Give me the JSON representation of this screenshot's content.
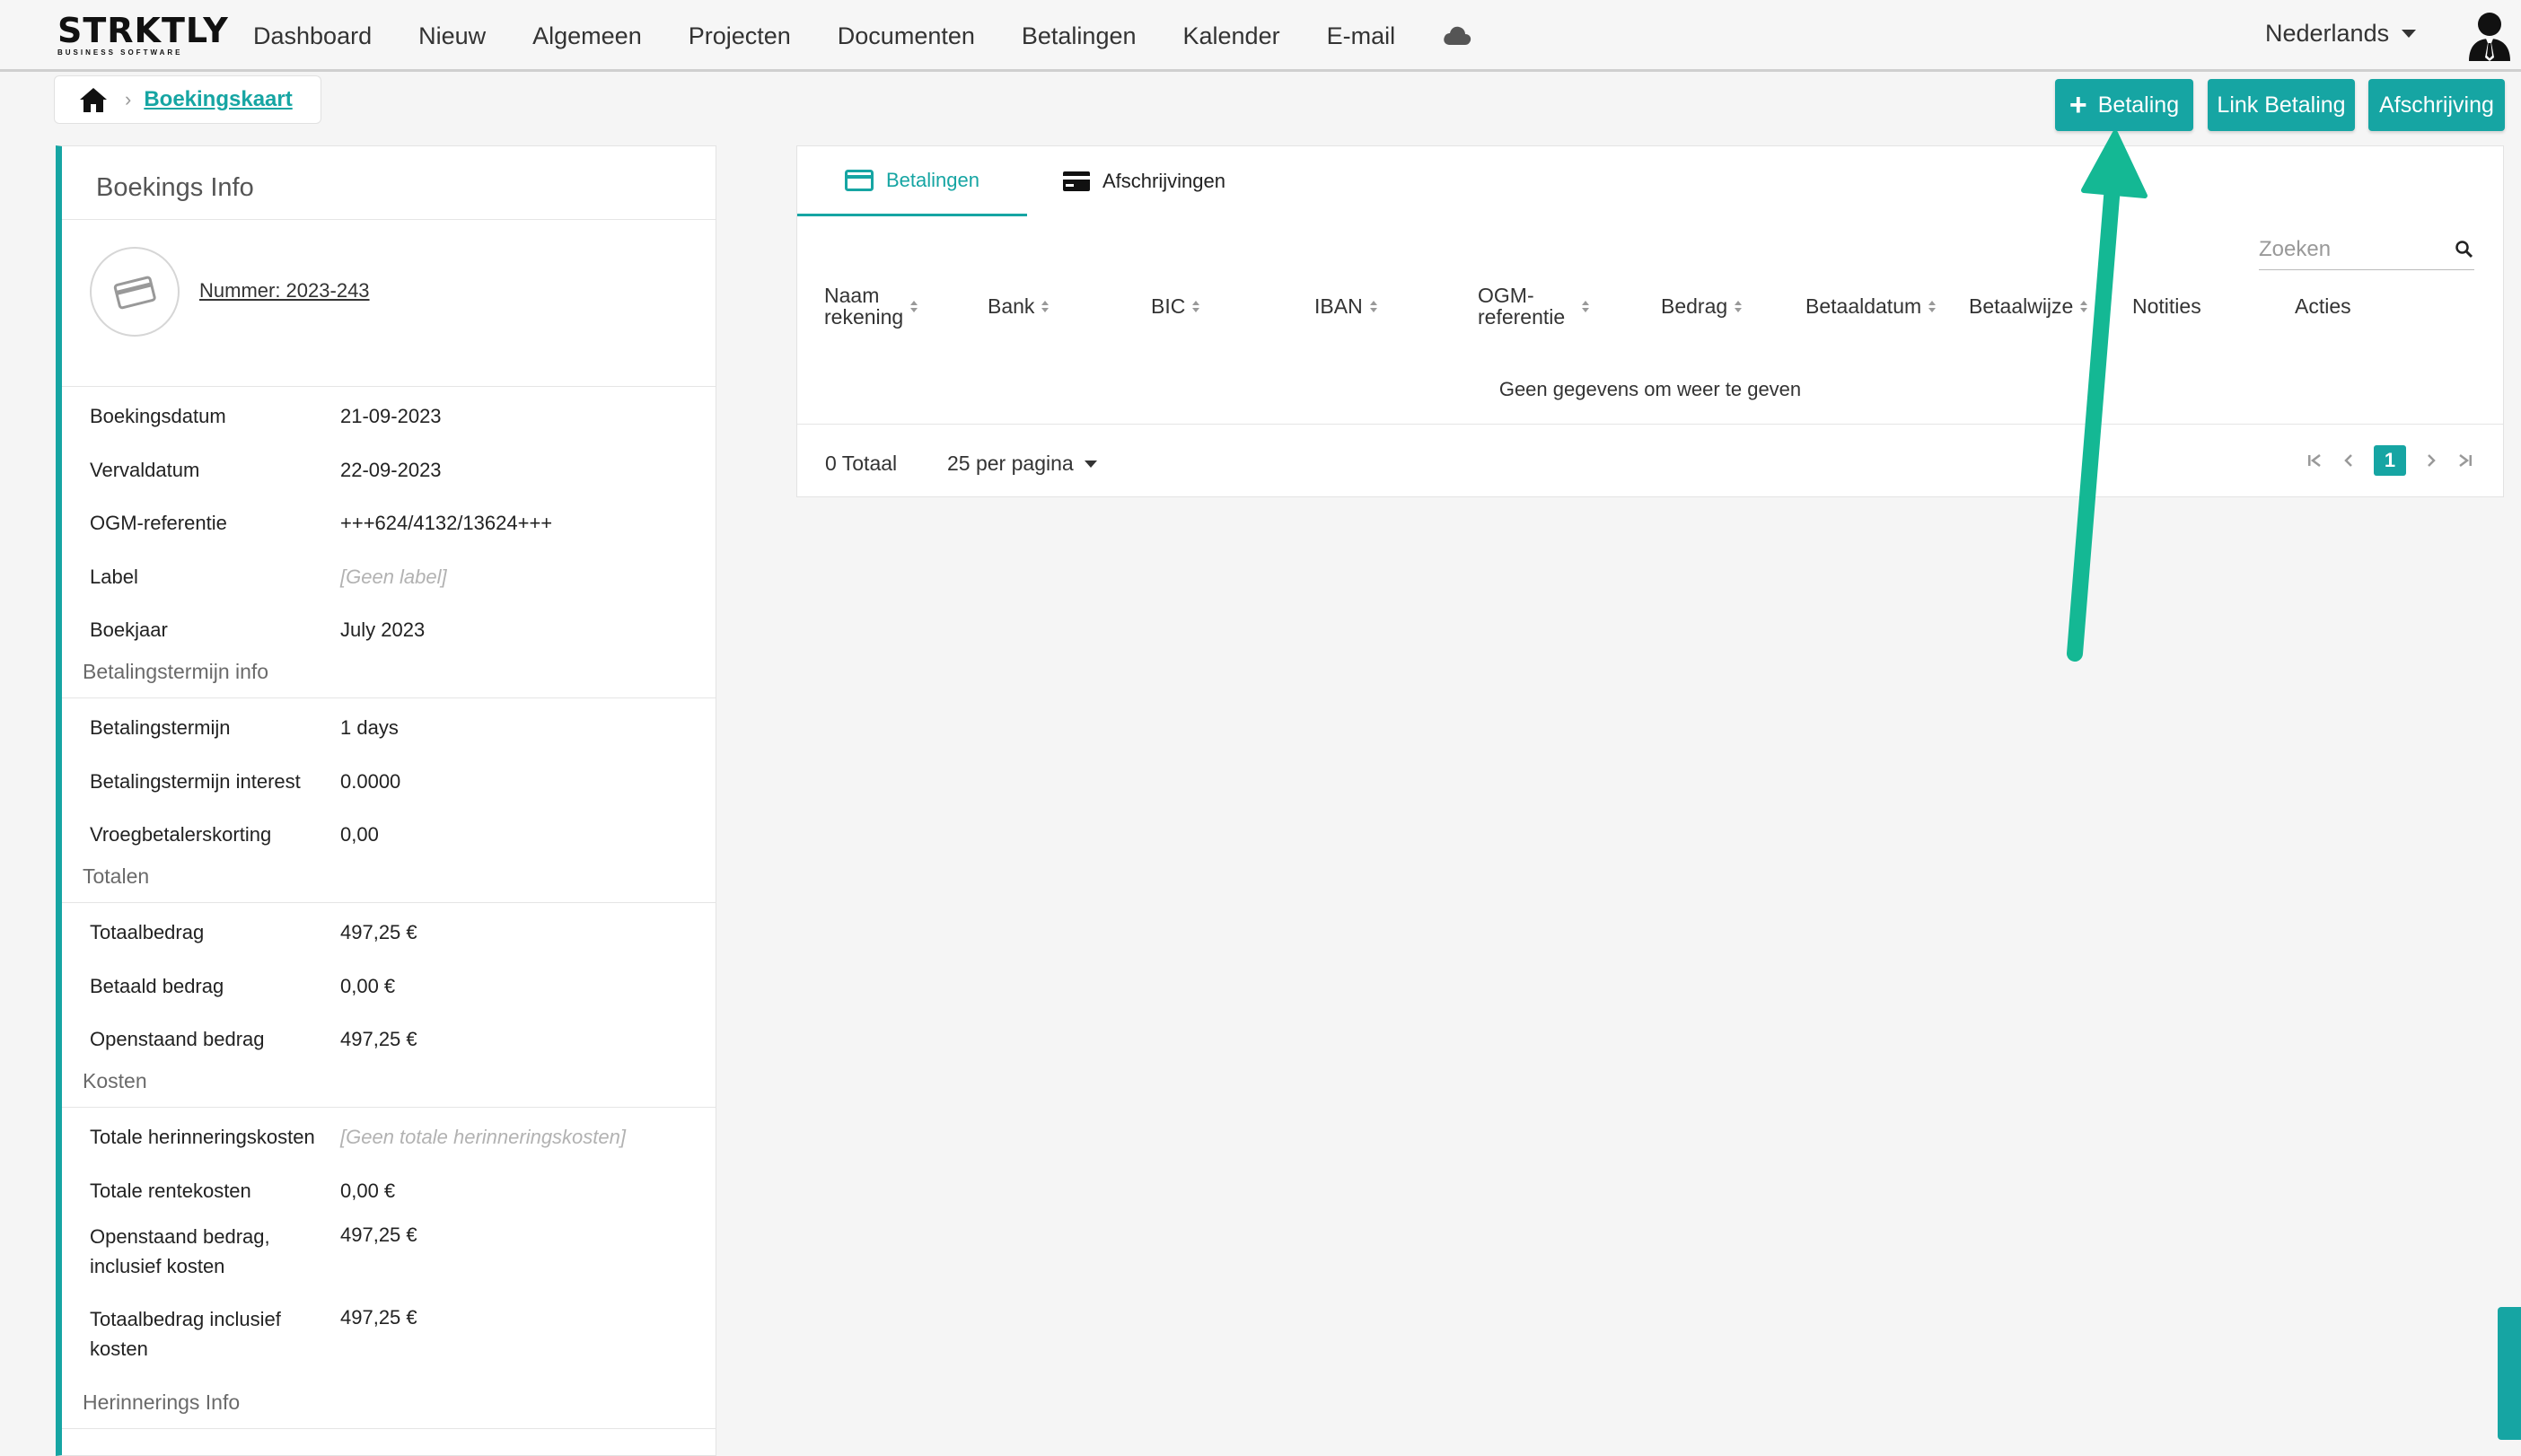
{
  "brand": {
    "name": "STRKTLY",
    "tagline": "BUSINESS SOFTWARE"
  },
  "nav": {
    "items": [
      "Dashboard",
      "Nieuw",
      "Algemeen",
      "Projecten",
      "Documenten",
      "Betalingen",
      "Kalender",
      "E-mail"
    ],
    "cloud_icon": "cloud-icon"
  },
  "language": "Nederlands",
  "breadcrumb": {
    "current": "Boekingskaart"
  },
  "actions": {
    "add_payment": "Betaling",
    "link_payment": "Link Betaling",
    "write_off": "Afschrijving"
  },
  "info": {
    "title": "Boekings Info",
    "number": "Nummer: 2023-243",
    "fields": [
      {
        "label": "Boekingsdatum",
        "value": "21-09-2023"
      },
      {
        "label": "Vervaldatum",
        "value": "22-09-2023"
      },
      {
        "label": "OGM-referentie",
        "value": "+++624/4132/13624+++"
      },
      {
        "label": "Label",
        "value": "[Geen label]"
      },
      {
        "label": "Boekjaar",
        "value": "July 2023"
      }
    ],
    "term_section": "Betalingstermijn info",
    "term_fields": [
      {
        "label": "Betalingstermijn",
        "value": "1 days"
      },
      {
        "label": "Betalingstermijn interest",
        "value": "0.0000"
      },
      {
        "label": "Vroegbetalerskorting",
        "value": "0,00"
      }
    ],
    "totals_section": "Totalen",
    "totals_fields": [
      {
        "label": "Totaalbedrag",
        "value": "497,25 €"
      },
      {
        "label": "Betaald bedrag",
        "value": "0,00 €"
      },
      {
        "label": "Openstaand bedrag",
        "value": "497,25 €"
      }
    ],
    "costs_section": "Kosten",
    "costs_fields": [
      {
        "label": "Totale herinneringskosten",
        "value": "[Geen totale herinneringskosten]"
      },
      {
        "label": "Totale rentekosten",
        "value": "0,00 €"
      },
      {
        "label": "Openstaand bedrag, inclusief kosten",
        "value": "497,25 €"
      },
      {
        "label": "Totaalbedrag inclusief kosten",
        "value": "497,25 €"
      }
    ],
    "reminders_section": "Herinnerings Info"
  },
  "tabs": [
    "Betalingen",
    "Afschrijvingen"
  ],
  "search": {
    "placeholder": "Zoeken"
  },
  "table": {
    "columns": [
      "Naam rekening",
      "Bank",
      "BIC",
      "IBAN",
      "OGM-referentie",
      "Bedrag",
      "Betaaldatum",
      "Betaalwijze",
      "Notities",
      "Acties"
    ],
    "empty": "Geen gegevens om weer te geven"
  },
  "footer": {
    "total": "0 Totaal",
    "per_page": "25 per pagina",
    "current_page": "1"
  },
  "colors": {
    "accent": "#16a5a3",
    "arrow": "#14b894"
  }
}
